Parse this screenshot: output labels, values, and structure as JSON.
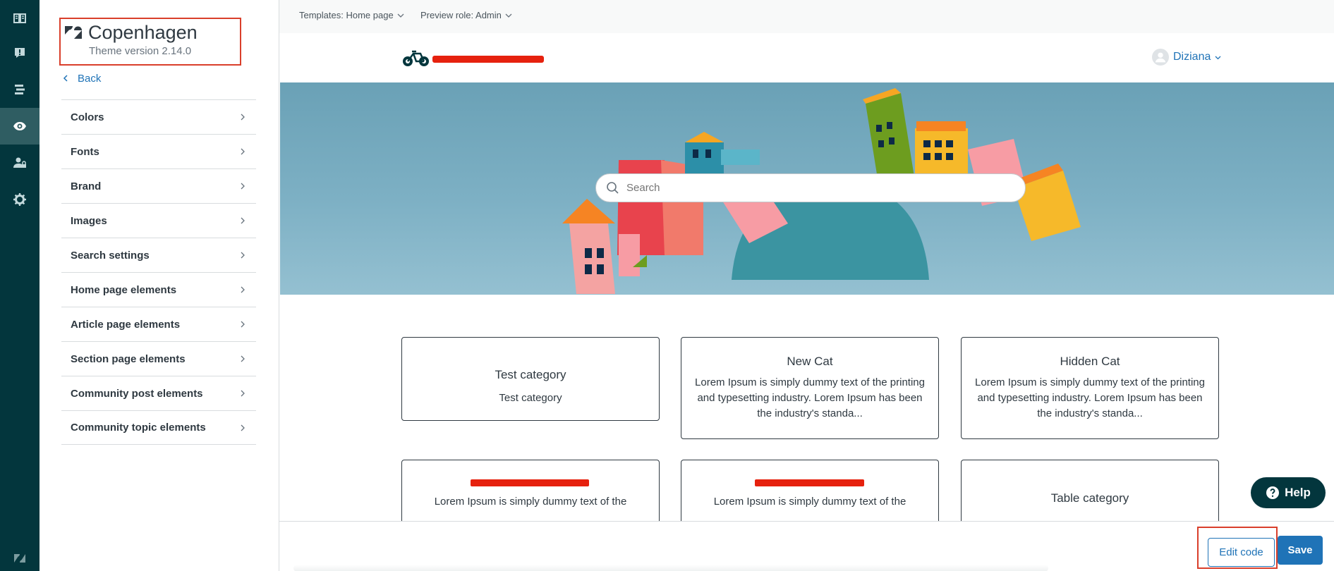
{
  "rail": {
    "items": [
      {
        "icon": "guide-icon"
      },
      {
        "icon": "support-icon"
      },
      {
        "icon": "community-icon"
      },
      {
        "icon": "eye-icon",
        "active": true
      },
      {
        "icon": "user-permissions-icon"
      },
      {
        "icon": "gear-icon"
      }
    ],
    "bottom_icon": "zendesk-logo-icon",
    "colors": {
      "background": "#03363d",
      "active": "#2f5d62"
    }
  },
  "theme": {
    "name": "Copenhagen",
    "version": "Theme version 2.14.0",
    "back_label": "Back"
  },
  "settings": {
    "items": [
      {
        "label": "Colors"
      },
      {
        "label": "Fonts"
      },
      {
        "label": "Brand"
      },
      {
        "label": "Images"
      },
      {
        "label": "Search settings"
      },
      {
        "label": "Home page elements"
      },
      {
        "label": "Article page elements"
      },
      {
        "label": "Section page elements"
      },
      {
        "label": "Community post elements"
      },
      {
        "label": "Community topic elements"
      }
    ]
  },
  "toolbar": {
    "template_label": "Templates: Home page",
    "role_label": "Preview role: Admin"
  },
  "site": {
    "user_name": "Diziana",
    "search_placeholder": "Search",
    "categories": [
      {
        "title": "Test category",
        "description": "Test category"
      },
      {
        "title": "New Cat",
        "description": "Lorem Ipsum is simply dummy text of the printing and typesetting industry. Lorem Ipsum has been the industry's standa..."
      },
      {
        "title": "Hidden Cat",
        "description": "Lorem Ipsum is simply dummy text of the printing and typesetting industry. Lorem Ipsum has been the industry's standa..."
      },
      {
        "title": "",
        "description": "Lorem Ipsum is simply dummy text of the"
      },
      {
        "title": "",
        "description": "Lorem Ipsum is simply dummy text of the"
      },
      {
        "title": "Table category",
        "description": ""
      }
    ],
    "help_label": "Help"
  },
  "actions": {
    "edit_code_label": "Edit code",
    "save_label": "Save"
  },
  "colors": {
    "accent": "#1f73b7",
    "highlight_box": "#d93f2b",
    "redaction": "#e6210e"
  }
}
